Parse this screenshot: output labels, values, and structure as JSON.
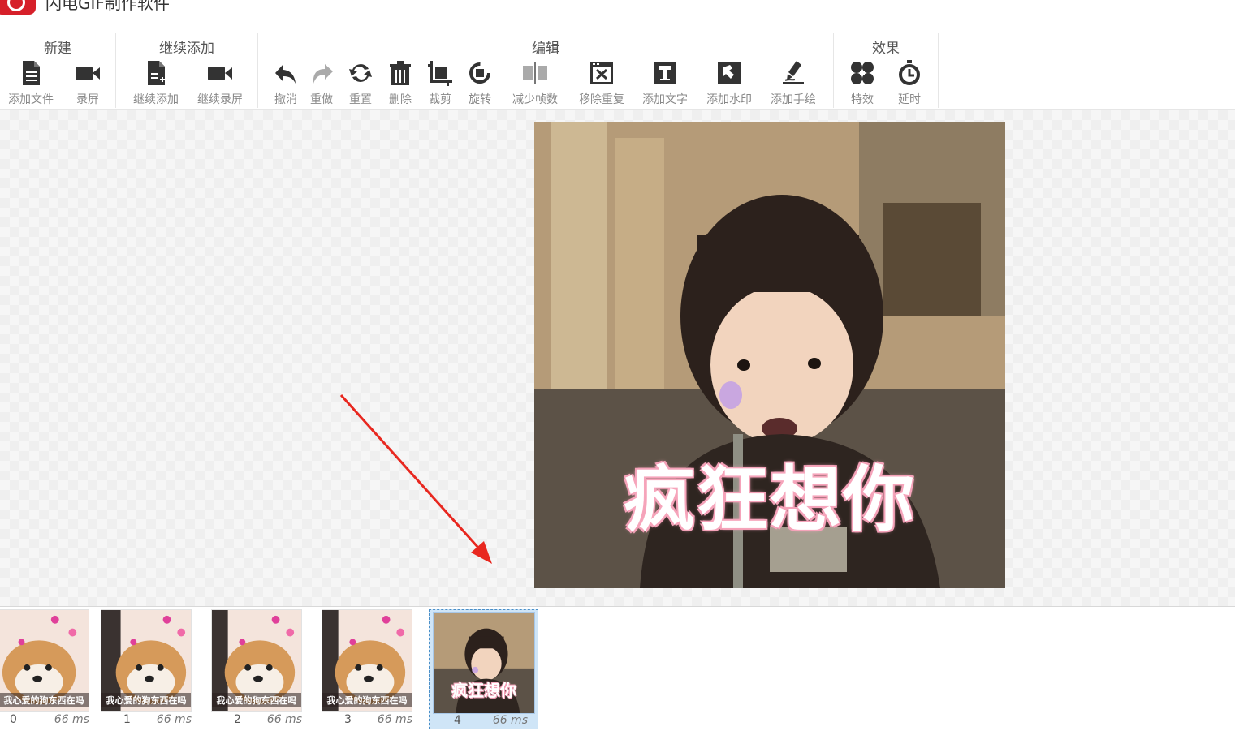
{
  "app": {
    "title": "闪电GIF制作软件"
  },
  "ribbon": {
    "groups": [
      {
        "title": "新建",
        "tools": [
          {
            "label": "添加文件",
            "icon": "add-file-icon"
          },
          {
            "label": "录屏",
            "icon": "video-camera-icon"
          }
        ]
      },
      {
        "title": "继续添加",
        "tools": [
          {
            "label": "继续添加",
            "icon": "continue-add-file-icon"
          },
          {
            "label": "继续录屏",
            "icon": "video-camera-icon"
          }
        ]
      },
      {
        "title": "编辑",
        "tools": [
          {
            "label": "撤消",
            "icon": "undo-icon"
          },
          {
            "label": "重做",
            "icon": "redo-icon"
          },
          {
            "label": "重置",
            "icon": "reset-icon"
          },
          {
            "label": "删除",
            "icon": "trash-icon"
          },
          {
            "label": "裁剪",
            "icon": "crop-icon"
          },
          {
            "label": "旋转",
            "icon": "rotate-icon"
          },
          {
            "label": "减少帧数",
            "icon": "reduce-frames-icon"
          },
          {
            "label": "移除重复",
            "icon": "remove-duplicates-icon"
          },
          {
            "label": "添加文字",
            "icon": "add-text-icon"
          },
          {
            "label": "添加水印",
            "icon": "watermark-icon"
          },
          {
            "label": "添加手绘",
            "icon": "pen-icon"
          }
        ]
      },
      {
        "title": "效果",
        "tools": [
          {
            "label": "特效",
            "icon": "effects-icon"
          },
          {
            "label": "延时",
            "icon": "timer-icon"
          }
        ]
      }
    ]
  },
  "preview": {
    "caption": "疯狂想你"
  },
  "filmstrip": {
    "frames": [
      {
        "index": "0",
        "delay": "66 ms",
        "caption": "我心爱的狗东西在吗",
        "selected": false
      },
      {
        "index": "1",
        "delay": "66 ms",
        "caption": "我心爱的狗东西在吗",
        "selected": false
      },
      {
        "index": "2",
        "delay": "66 ms",
        "caption": "我心爱的狗东西在吗",
        "selected": false
      },
      {
        "index": "3",
        "delay": "66 ms",
        "caption": "我心爱的狗东西在吗",
        "selected": false
      },
      {
        "index": "4",
        "delay": "66 ms",
        "caption": "疯狂想你",
        "selected": true
      }
    ]
  },
  "colors": {
    "accent": "#d6202a",
    "arrow": "#e8271f",
    "selection": "#cfe5f7",
    "icon": "#333333"
  }
}
